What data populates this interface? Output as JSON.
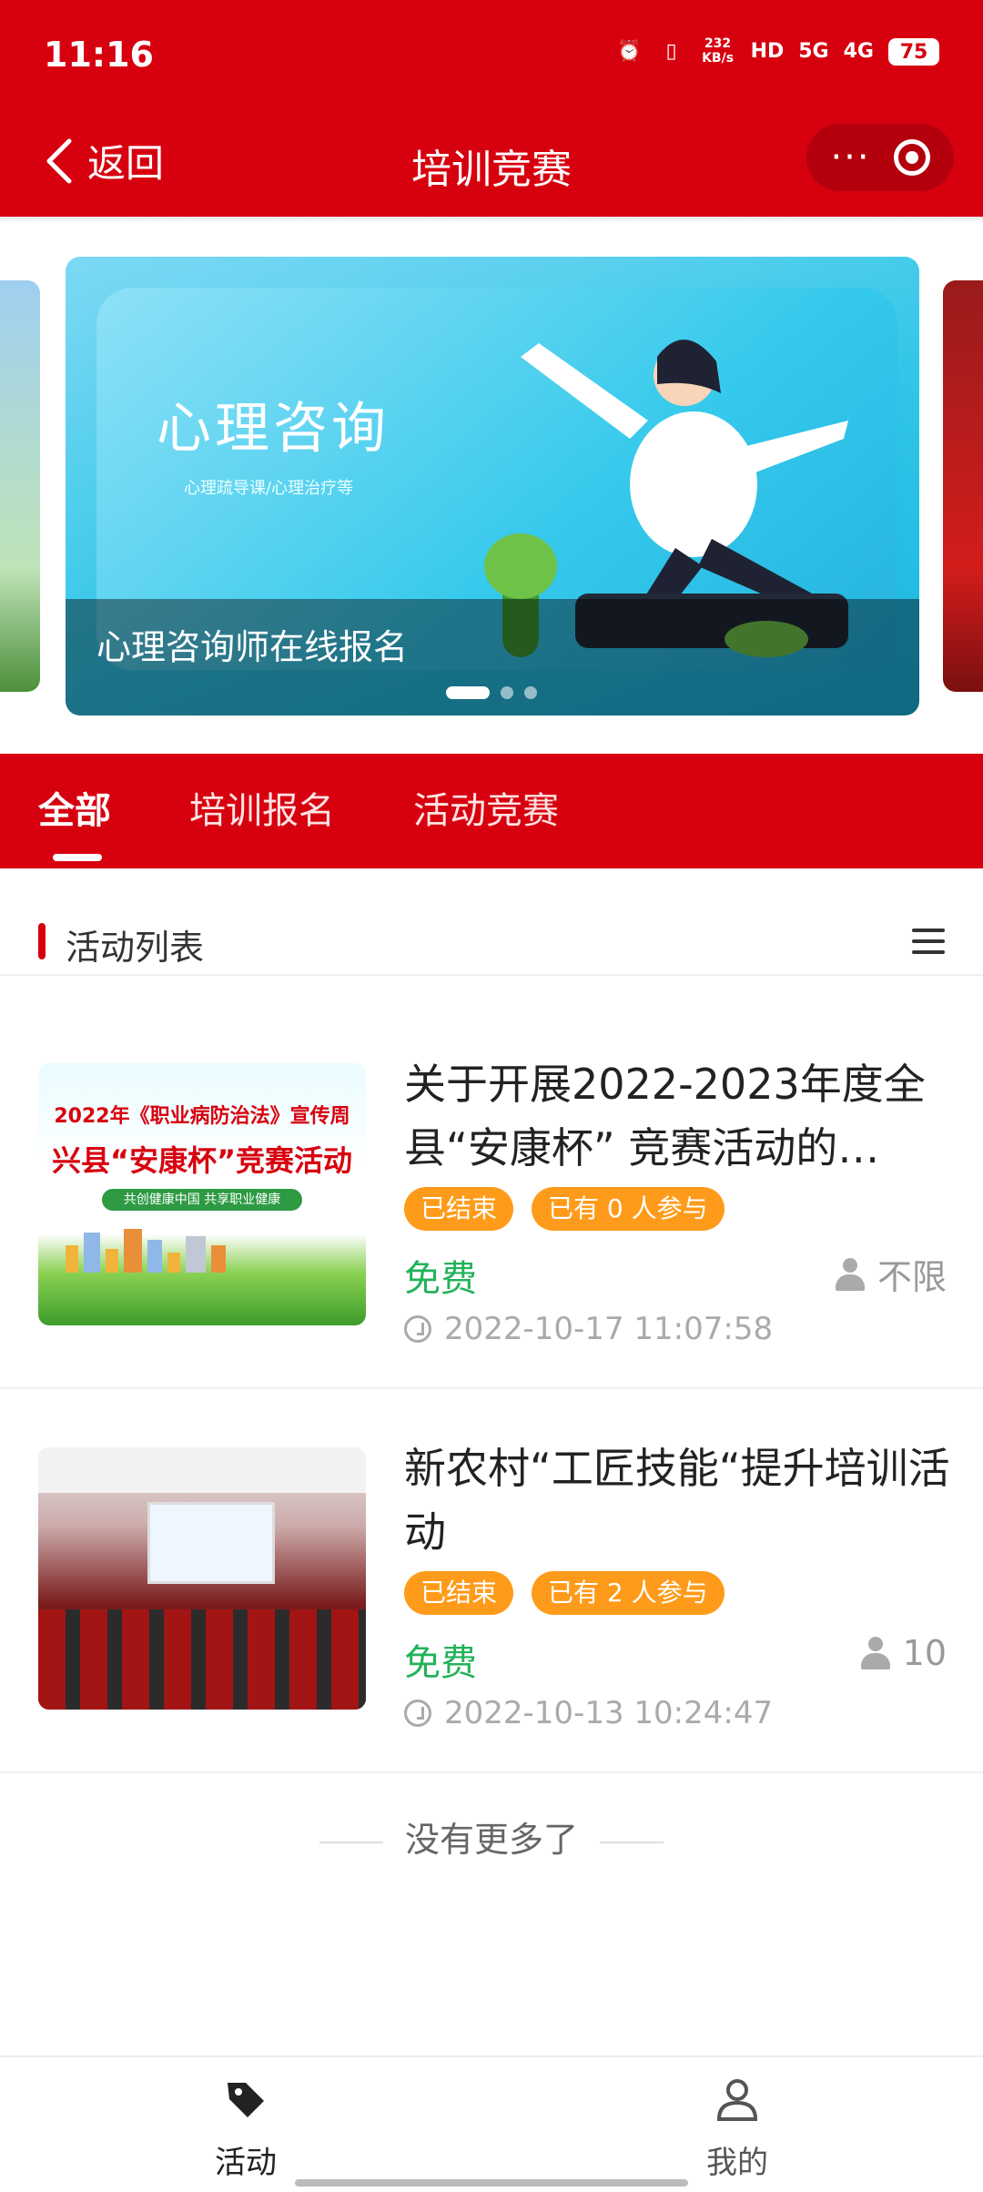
{
  "status_bar": {
    "time": "11:16",
    "net_speed": "232 KB/s",
    "hd": "HD",
    "signal_1": "5G",
    "signal_2": "4G",
    "battery": "75"
  },
  "nav": {
    "back_label": "返回",
    "title": "培训竞赛",
    "more_glyph": "···"
  },
  "banner": {
    "caption": "心理咨询师在线报名",
    "slide_heading": "心理咨询",
    "slide_subheading": "心理疏导课/心理治疗等",
    "slide_count": 3,
    "active_index": 0
  },
  "tabs": [
    {
      "label": "全部",
      "active": true
    },
    {
      "label": "培训报名",
      "active": false
    },
    {
      "label": "活动竞赛",
      "active": false
    }
  ],
  "section": {
    "title": "活动列表"
  },
  "activities": [
    {
      "title": "关于开展2022-2023年度全县“安康杯” 竞赛活动的…",
      "status": "已结束",
      "participants": "已有 0 人参与",
      "price": "免费",
      "limit": "不限",
      "datetime": "2022-10-17 11:07:58",
      "thumb_title": "2022年《职业病防治法》宣传周",
      "thumb_headline": "兴县“安康杯”竞赛活动",
      "thumb_slogan": "共创健康中国 共享职业健康"
    },
    {
      "title": "新农村“工匠技能“提升培训活动",
      "status": "已结束",
      "participants": "已有 2 人参与",
      "price": "免费",
      "limit": "10",
      "datetime": "2022-10-13 10:24:47"
    }
  ],
  "footer": {
    "no_more": "没有更多了"
  },
  "tabbar": {
    "activity_label": "活动",
    "mine_label": "我的"
  },
  "colors": {
    "brand_red": "#d7000f",
    "badge_orange": "#ff9b1a",
    "free_green": "#22b259"
  }
}
